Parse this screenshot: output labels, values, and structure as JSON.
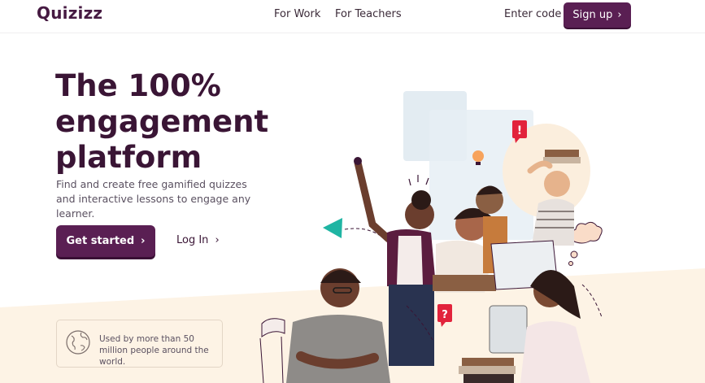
{
  "header": {
    "logo": "Quizizz",
    "nav": [
      "For Work",
      "For Teachers"
    ],
    "enter_code": "Enter code",
    "signup": "Sign up"
  },
  "hero": {
    "title_lines": [
      "The 100%",
      "engagement",
      "platform"
    ],
    "subtitle": "Find and create free gamified quizzes and interactive lessons to engage any learner.",
    "cta": "Get started",
    "login": "Log In"
  },
  "stat": {
    "text": "Used by more than 50 million people around the world."
  },
  "colors": {
    "brand": "#5a1f53",
    "title": "#3a1535",
    "beige": "#fdf3e5",
    "teal": "#1fb5a3",
    "red": "#e2233c"
  },
  "icons": [
    "chevron-right-icon",
    "globe-icon",
    "question-mark-icon",
    "exclamation-icon",
    "lightbulb-icon",
    "thought-cloud-icon",
    "triangle-icon"
  ]
}
